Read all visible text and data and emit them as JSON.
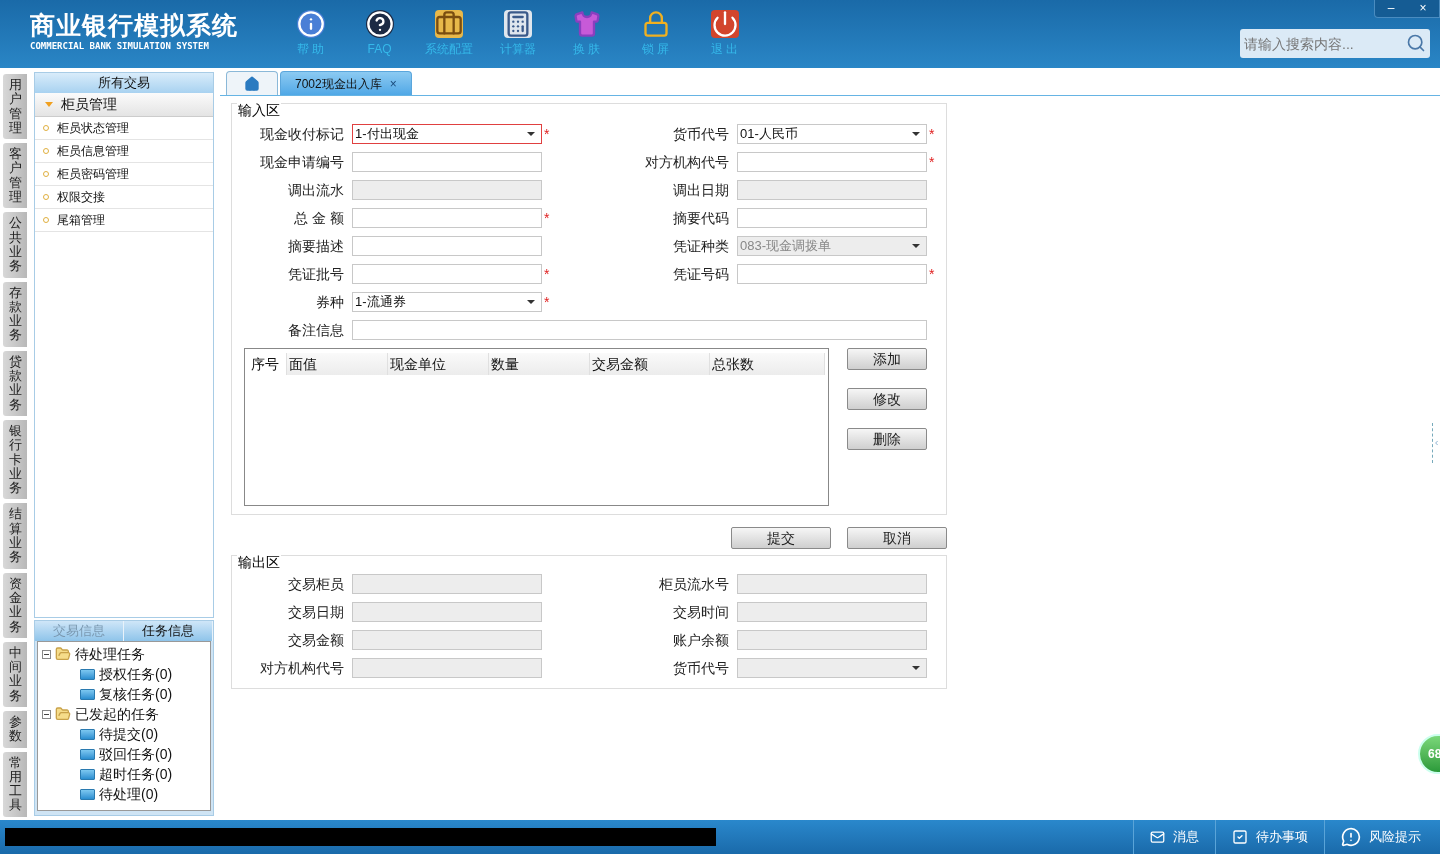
{
  "header": {
    "title": "商业银行模拟系统",
    "subtitle": "COMMERCIAL BANK SIMULATION SYSTEM",
    "tools": [
      {
        "kind": "help",
        "label": "帮 助"
      },
      {
        "kind": "faq",
        "label": "FAQ"
      },
      {
        "kind": "config",
        "label": "系统配置"
      },
      {
        "kind": "calculator",
        "label": "计算器"
      },
      {
        "kind": "skin",
        "label": "换 肤"
      },
      {
        "kind": "lock",
        "label": "锁 屏"
      },
      {
        "kind": "exit",
        "label": "退 出"
      }
    ],
    "search": {
      "placeholder": "请输入搜索内容..."
    }
  },
  "window_controls": [
    "–",
    "×"
  ],
  "side_tabs": [
    "用户管理",
    "客户管理",
    "公共业务",
    "存款业务",
    "贷款业务",
    "银行卡业务",
    "结算业务",
    "资金业务",
    "中间业务",
    "参数",
    "常用工具"
  ],
  "menu": {
    "title": "所有交易",
    "group": {
      "label": "柜员管理",
      "expanded": true,
      "items": [
        "柜员状态管理",
        "柜员信息管理",
        "柜员密码管理",
        "权限交接",
        "尾箱管理"
      ]
    }
  },
  "info_tabs": [
    {
      "label": "交易信息",
      "selected": false
    },
    {
      "label": "任务信息",
      "selected": true
    }
  ],
  "task_tree": [
    {
      "label": "待处理任务",
      "expanded": true,
      "children": [
        {
          "label": "授权任务(0)"
        },
        {
          "label": "复核任务(0)"
        }
      ]
    },
    {
      "label": "已发起的任务",
      "expanded": true,
      "children": [
        {
          "label": "待提交(0)"
        },
        {
          "label": "驳回任务(0)"
        },
        {
          "label": "超时任务(0)"
        },
        {
          "label": "待处理(0)"
        }
      ]
    }
  ],
  "tabs": [
    {
      "kind": "home",
      "selected": false
    },
    {
      "kind": "page",
      "label": "7002现金出入库",
      "close": "×",
      "selected": true
    }
  ],
  "input_area": {
    "title": "输入区",
    "required_mark": "*",
    "rows": [
      [
        {
          "label": "现金收付标记",
          "kind": "select",
          "value": "1-付出现金",
          "required": true,
          "disabled": false,
          "focused": true
        },
        {
          "label": "货币代号",
          "kind": "select",
          "value": "01-人民币",
          "required": true,
          "disabled": false,
          "focused": false
        }
      ],
      [
        {
          "label": "现金申请编号",
          "kind": "text",
          "required": false,
          "disabled": false,
          "focused": false
        },
        {
          "label": "对方机构代号",
          "kind": "text",
          "required": true,
          "disabled": false,
          "focused": false
        }
      ],
      [
        {
          "label": "调出流水",
          "kind": "text",
          "required": false,
          "disabled": true,
          "focused": false
        },
        {
          "label": "调出日期",
          "kind": "text",
          "required": false,
          "disabled": true,
          "focused": false
        }
      ],
      [
        {
          "label": "总 金 额",
          "kind": "text",
          "required": true,
          "disabled": false,
          "focused": false
        },
        {
          "label": "摘要代码",
          "kind": "text",
          "required": false,
          "disabled": false,
          "focused": false
        }
      ],
      [
        {
          "label": "摘要描述",
          "kind": "text",
          "required": false,
          "disabled": false,
          "focused": false
        },
        {
          "label": "凭证种类",
          "kind": "select",
          "value": "083-现金调拨单",
          "required": false,
          "disabled": true,
          "focused": false
        }
      ],
      [
        {
          "label": "凭证批号",
          "kind": "text",
          "required": true,
          "disabled": false,
          "focused": false
        },
        {
          "label": "凭证号码",
          "kind": "text",
          "required": true,
          "disabled": false,
          "focused": false
        }
      ],
      [
        {
          "label": "券种",
          "kind": "select",
          "value": "1-流通券",
          "required": true,
          "disabled": false,
          "focused": false
        }
      ]
    ],
    "remarks": {
      "label": "备注信息"
    },
    "table": {
      "columns": [
        "序号",
        "面值",
        "现金单位",
        "数量",
        "交易金额",
        "总张数"
      ]
    },
    "table_buttons": [
      "添加",
      "修改",
      "删除"
    ]
  },
  "actions": [
    "提交",
    "取消"
  ],
  "output_area": {
    "title": "输出区",
    "rows": [
      [
        {
          "label": "交易柜员",
          "kind": "text"
        },
        {
          "label": "柜员流水号",
          "kind": "text"
        }
      ],
      [
        {
          "label": "交易日期",
          "kind": "text"
        },
        {
          "label": "交易时间",
          "kind": "text"
        }
      ],
      [
        {
          "label": "交易金额",
          "kind": "text"
        },
        {
          "label": "账户余额",
          "kind": "text"
        }
      ],
      [
        {
          "label": "对方机构代号",
          "kind": "text"
        },
        {
          "label": "货币代号",
          "kind": "select"
        }
      ]
    ]
  },
  "float_badge": "68",
  "status_bar": [
    {
      "kind": "message",
      "label": "消息"
    },
    {
      "kind": "todo",
      "label": "待办事项"
    },
    {
      "kind": "risk",
      "label": "风险提示"
    }
  ]
}
